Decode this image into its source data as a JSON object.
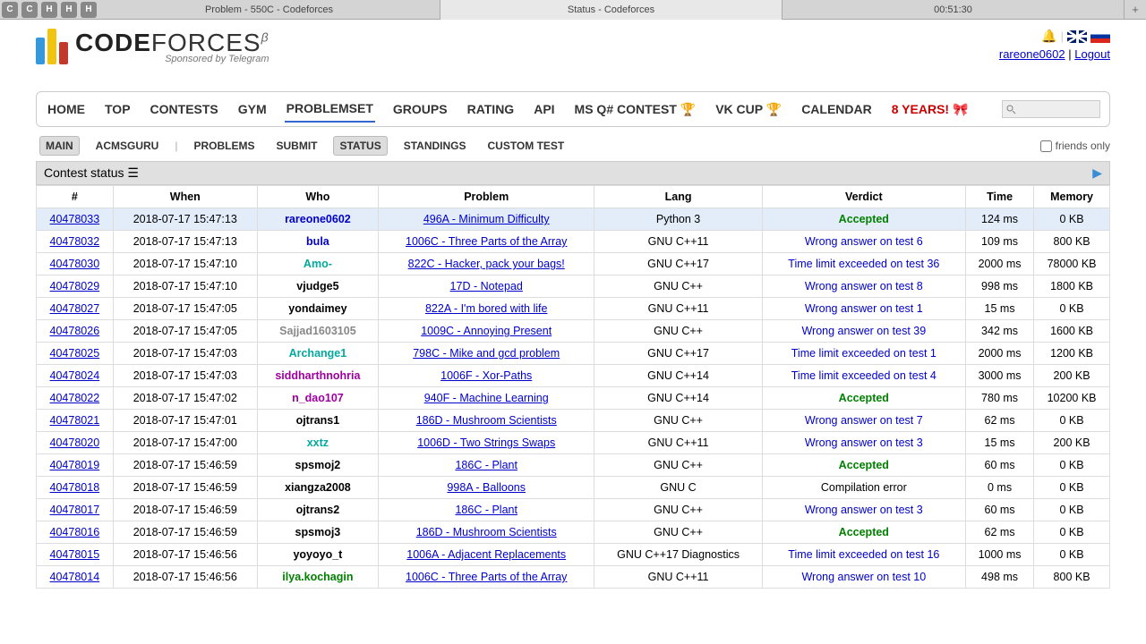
{
  "browser": {
    "tabs": [
      {
        "title": "Problem - 550C - Codeforces"
      },
      {
        "title": "Status - Codeforces"
      }
    ],
    "timer": "00:51:30"
  },
  "header": {
    "logo_bold": "CODE",
    "logo_rest": "FORCES",
    "sponsor": "Sponsored by Telegram",
    "user": "rareone0602",
    "logout": "Logout"
  },
  "nav": {
    "items": [
      "HOME",
      "TOP",
      "CONTESTS",
      "GYM",
      "PROBLEMSET",
      "GROUPS",
      "RATING",
      "API",
      "MS Q# CONTEST 🏆",
      "VK CUP 🏆",
      "CALENDAR"
    ],
    "eight_years": "8 YEARS! 🎀",
    "active_index": 4
  },
  "subnav": {
    "left": [
      "MAIN",
      "ACMSGURU"
    ],
    "right": [
      "PROBLEMS",
      "SUBMIT",
      "STATUS",
      "STANDINGS",
      "CUSTOM TEST"
    ],
    "active_index": 2,
    "friends_only": "friends only"
  },
  "panel": {
    "title": "Contest status"
  },
  "columns": [
    "#",
    "When",
    "Who",
    "Problem",
    "Lang",
    "Verdict",
    "Time",
    "Memory"
  ],
  "rows": [
    {
      "id": "40478033",
      "when": "2018-07-17 15:47:13",
      "who": "rareone0602",
      "who_class": "blue",
      "problem": "496A - Minimum Difficulty",
      "lang": "Python 3",
      "verdict": "Accepted",
      "vclass": "ok",
      "time": "124 ms",
      "mem": "0 KB",
      "hl": true
    },
    {
      "id": "40478032",
      "when": "2018-07-17 15:47:13",
      "who": "bula",
      "who_class": "blue",
      "problem": "1006C - Three Parts of the Array",
      "lang": "GNU C++11",
      "verdict": "Wrong answer on test 6",
      "vclass": "wa",
      "time": "109 ms",
      "mem": "800 KB"
    },
    {
      "id": "40478030",
      "when": "2018-07-17 15:47:10",
      "who": "Amo-",
      "who_class": "cyan",
      "problem": "822C - Hacker, pack your bags!",
      "lang": "GNU C++17",
      "verdict": "Time limit exceeded on test 36",
      "vclass": "tle",
      "time": "2000 ms",
      "mem": "78000 KB"
    },
    {
      "id": "40478029",
      "when": "2018-07-17 15:47:10",
      "who": "vjudge5",
      "who_class": "black",
      "problem": "17D - Notepad",
      "lang": "GNU C++",
      "verdict": "Wrong answer on test 8",
      "vclass": "wa",
      "time": "998 ms",
      "mem": "1800 KB"
    },
    {
      "id": "40478027",
      "when": "2018-07-17 15:47:05",
      "who": "yondaimey",
      "who_class": "black",
      "problem": "822A - I'm bored with life",
      "lang": "GNU C++11",
      "verdict": "Wrong answer on test 1",
      "vclass": "wa",
      "time": "15 ms",
      "mem": "0 KB"
    },
    {
      "id": "40478026",
      "when": "2018-07-17 15:47:05",
      "who": "Sajjad1603105",
      "who_class": "gray",
      "problem": "1009C - Annoying Present",
      "lang": "GNU C++",
      "verdict": "Wrong answer on test 39",
      "vclass": "wa",
      "time": "342 ms",
      "mem": "1600 KB"
    },
    {
      "id": "40478025",
      "when": "2018-07-17 15:47:03",
      "who": "Archange1",
      "who_class": "cyan",
      "problem": "798C - Mike and gcd problem",
      "lang": "GNU C++17",
      "verdict": "Time limit exceeded on test 1",
      "vclass": "tle",
      "time": "2000 ms",
      "mem": "1200 KB"
    },
    {
      "id": "40478024",
      "when": "2018-07-17 15:47:03",
      "who": "siddharthnohria",
      "who_class": "purple",
      "problem": "1006F - Xor-Paths",
      "lang": "GNU C++14",
      "verdict": "Time limit exceeded on test 4",
      "vclass": "tle",
      "time": "3000 ms",
      "mem": "200 KB"
    },
    {
      "id": "40478022",
      "when": "2018-07-17 15:47:02",
      "who": "n_dao107",
      "who_class": "purple",
      "problem": "940F - Machine Learning",
      "lang": "GNU C++14",
      "verdict": "Accepted",
      "vclass": "ok",
      "time": "780 ms",
      "mem": "10200 KB"
    },
    {
      "id": "40478021",
      "when": "2018-07-17 15:47:01",
      "who": "ojtrans1",
      "who_class": "black",
      "problem": "186D - Mushroom Scientists",
      "lang": "GNU C++",
      "verdict": "Wrong answer on test 7",
      "vclass": "wa",
      "time": "62 ms",
      "mem": "0 KB"
    },
    {
      "id": "40478020",
      "when": "2018-07-17 15:47:00",
      "who": "xxtz",
      "who_class": "cyan",
      "problem": "1006D - Two Strings Swaps",
      "lang": "GNU C++11",
      "verdict": "Wrong answer on test 3",
      "vclass": "wa",
      "time": "15 ms",
      "mem": "200 KB"
    },
    {
      "id": "40478019",
      "when": "2018-07-17 15:46:59",
      "who": "spsmoj2",
      "who_class": "black",
      "problem": "186C - Plant",
      "lang": "GNU C++",
      "verdict": "Accepted",
      "vclass": "ok",
      "time": "60 ms",
      "mem": "0 KB"
    },
    {
      "id": "40478018",
      "when": "2018-07-17 15:46:59",
      "who": "xiangza2008",
      "who_class": "black",
      "problem": "998A - Balloons",
      "lang": "GNU C",
      "verdict": "Compilation error",
      "vclass": "ce",
      "time": "0 ms",
      "mem": "0 KB"
    },
    {
      "id": "40478017",
      "when": "2018-07-17 15:46:59",
      "who": "ojtrans2",
      "who_class": "black",
      "problem": "186C - Plant",
      "lang": "GNU C++",
      "verdict": "Wrong answer on test 3",
      "vclass": "wa",
      "time": "60 ms",
      "mem": "0 KB"
    },
    {
      "id": "40478016",
      "when": "2018-07-17 15:46:59",
      "who": "spsmoj3",
      "who_class": "black",
      "problem": "186D - Mushroom Scientists",
      "lang": "GNU C++",
      "verdict": "Accepted",
      "vclass": "ok",
      "time": "62 ms",
      "mem": "0 KB"
    },
    {
      "id": "40478015",
      "when": "2018-07-17 15:46:56",
      "who": "yoyoyo_t",
      "who_class": "black",
      "problem": "1006A - Adjacent Replacements",
      "lang": "GNU C++17 Diagnostics",
      "verdict": "Time limit exceeded on test 16",
      "vclass": "tle",
      "time": "1000 ms",
      "mem": "0 KB"
    },
    {
      "id": "40478014",
      "when": "2018-07-17 15:46:56",
      "who": "ilya.kochagin",
      "who_class": "green",
      "problem": "1006C - Three Parts of the Array",
      "lang": "GNU C++11",
      "verdict": "Wrong answer on test 10",
      "vclass": "wa",
      "time": "498 ms",
      "mem": "800 KB"
    }
  ]
}
